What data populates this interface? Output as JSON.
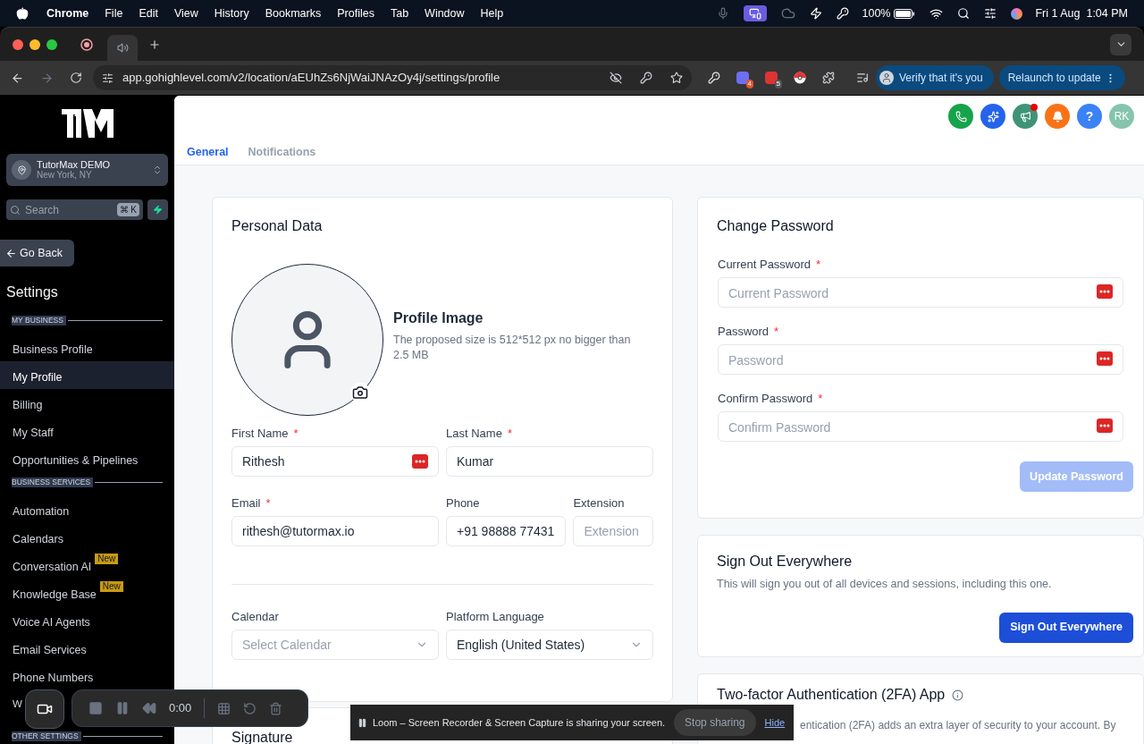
{
  "menubar": {
    "app": "Chrome",
    "items": [
      "File",
      "Edit",
      "View",
      "History",
      "Bookmarks",
      "Profiles",
      "Tab",
      "Window",
      "Help"
    ],
    "battery": "100%",
    "clock": "Fri 1 Aug  1:04 PM"
  },
  "browser": {
    "url": "app.gohighlevel.com/v2/location/aEUhZs6NjWaiJNAzOy4j/settings/profile",
    "extension_badges": [
      "4",
      "5"
    ],
    "verify": "Verify that it's you",
    "relaunch": "Relaunch to update"
  },
  "sidebar": {
    "account": {
      "name": "TutorMax DEMO",
      "location": "New York, NY"
    },
    "search": {
      "placeholder": "Search",
      "shortcut": "⌘ K"
    },
    "back": "Go Back",
    "title": "Settings",
    "sections": [
      {
        "heading": "MY BUSINESS",
        "items": [
          {
            "label": "Business Profile",
            "selected": false
          },
          {
            "label": "My Profile",
            "selected": true
          },
          {
            "label": "Billing",
            "selected": false
          },
          {
            "label": "My Staff",
            "selected": false
          },
          {
            "label": "Opportunities & Pipelines",
            "selected": false
          }
        ]
      },
      {
        "heading": "BUSINESS SERVICES",
        "items": [
          {
            "label": "Automation",
            "selected": false
          },
          {
            "label": "Calendars",
            "selected": false
          },
          {
            "label": "Conversation AI",
            "selected": false,
            "badge": "New"
          },
          {
            "label": "Knowledge Base",
            "selected": false,
            "badge": "New"
          },
          {
            "label": "Voice AI Agents",
            "selected": false
          },
          {
            "label": "Email Services",
            "selected": false
          },
          {
            "label": "Phone Numbers",
            "selected": false
          },
          {
            "label": "W",
            "selected": false
          }
        ]
      },
      {
        "heading": "OTHER SETTINGS"
      }
    ]
  },
  "header": {
    "help": "?",
    "avatar": "RK",
    "tabs": [
      {
        "label": "General",
        "selected": true
      },
      {
        "label": "Notifications",
        "selected": false
      }
    ]
  },
  "personal": {
    "title": "Personal Data",
    "image_title": "Profile Image",
    "image_hint": "The proposed size is 512*512 px no bigger than 2.5 MB",
    "rows": [
      [
        {
          "label": "First Name",
          "required_mark": "*",
          "value": "Rithesh",
          "kind": "autofill"
        },
        {
          "label": "Last Name",
          "required_mark": "*",
          "value": "Kumar",
          "kind": "text"
        }
      ],
      [
        {
          "label": "Email",
          "required_mark": "*",
          "value": "rithesh@tutormax.io",
          "kind": "text"
        },
        {
          "label": "Phone",
          "value": "+91 98888 77431",
          "kind": "text"
        },
        {
          "label": "Extension",
          "placeholder": "Extension",
          "kind": "text"
        }
      ]
    ],
    "selects": [
      {
        "label": "Calendar",
        "placeholder": "Select Calendar",
        "kind": "select"
      },
      {
        "label": "Platform Language",
        "value": "English (United States)",
        "kind": "select"
      }
    ]
  },
  "signature": {
    "title": "Signature"
  },
  "password": {
    "title": "Change Password",
    "fields": [
      {
        "label": "Current Password",
        "required_mark": "*",
        "placeholder": "Current Password",
        "kind": "password"
      },
      {
        "label": "Password",
        "required_mark": "*",
        "placeholder": "Password",
        "kind": "password"
      },
      {
        "label": "Confirm Password",
        "required_mark": "*",
        "placeholder": "Confirm Password",
        "kind": "password"
      }
    ],
    "button": {
      "label": "Update Password",
      "disabled": true
    }
  },
  "signout": {
    "title": "Sign Out Everywhere",
    "text": "This will sign you out of all devices and sessions, including this one.",
    "button": "Sign Out Everywhere"
  },
  "twofa": {
    "title": "Two-factor Authentication (2FA) App",
    "text": "entication (2FA) adds an extra layer of security to your account. By"
  },
  "loom": {
    "timer": "0:00",
    "message": "Loom – Screen Recorder & Screen Capture is sharing your screen.",
    "stop": "Stop sharing",
    "hide": "Hide"
  }
}
